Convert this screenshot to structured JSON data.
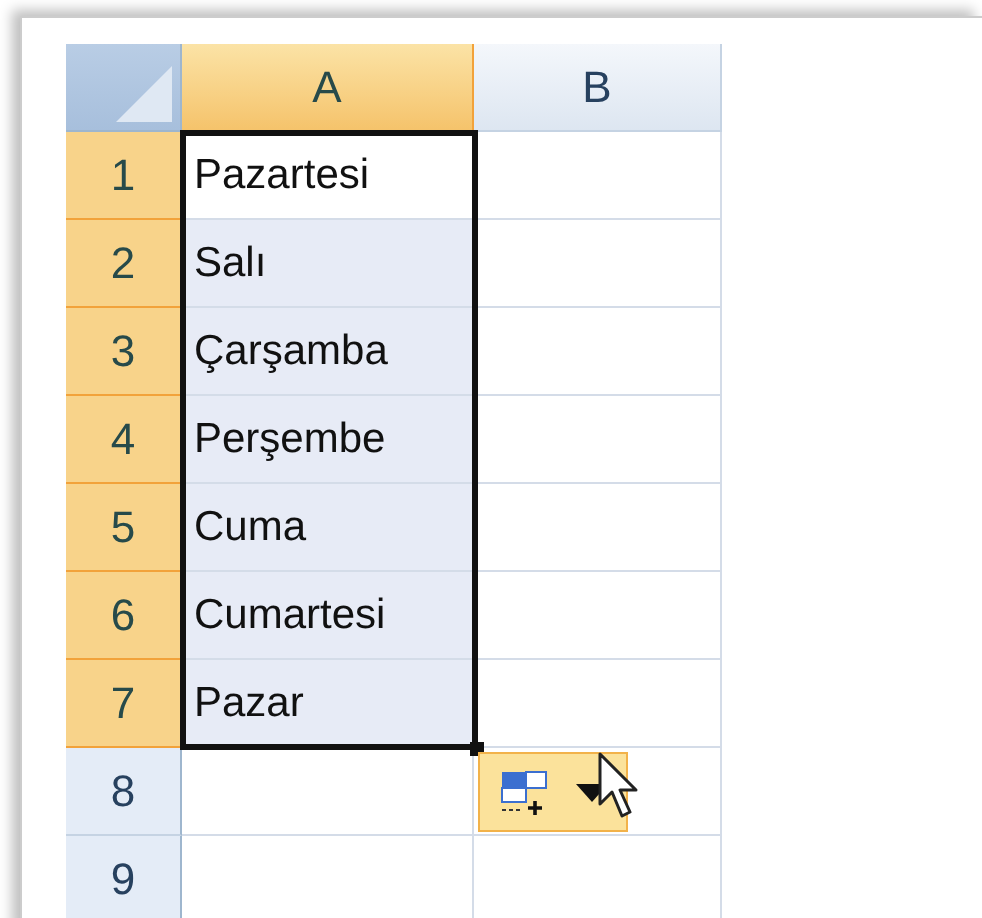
{
  "columns": [
    {
      "label": "A",
      "selected": true
    },
    {
      "label": "B",
      "selected": false
    }
  ],
  "rows": [
    {
      "number": "1",
      "selected": true,
      "active": true,
      "value": "Pazartesi"
    },
    {
      "number": "2",
      "selected": true,
      "active": false,
      "value": "Salı"
    },
    {
      "number": "3",
      "selected": true,
      "active": false,
      "value": "Çarşamba"
    },
    {
      "number": "4",
      "selected": true,
      "active": false,
      "value": "Perşembe"
    },
    {
      "number": "5",
      "selected": true,
      "active": false,
      "value": "Cuma"
    },
    {
      "number": "6",
      "selected": true,
      "active": false,
      "value": "Cumartesi"
    },
    {
      "number": "7",
      "selected": true,
      "active": false,
      "value": "Pazar"
    },
    {
      "number": "8",
      "selected": false
    },
    {
      "number": "9",
      "selected": false
    }
  ],
  "autofill_button": {
    "hovered": true
  }
}
